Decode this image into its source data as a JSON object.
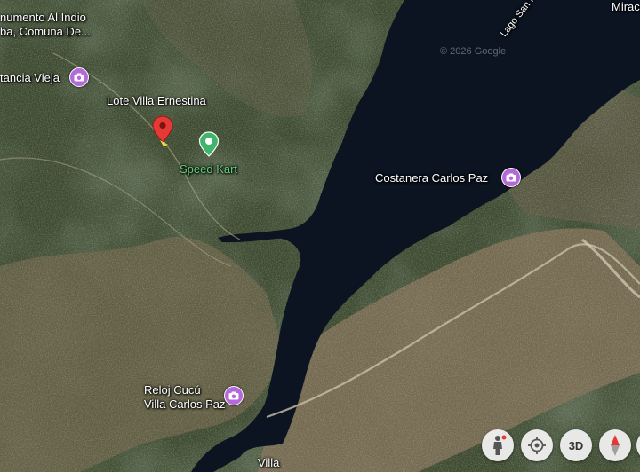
{
  "map": {
    "attribution": "© 2026 Google",
    "labels": {
      "monumento_line1": "numento Al Indio",
      "monumento_line2": "ba, Comuna De...",
      "estancia": "tancia Vieja",
      "lote": "Lote Villa Ernestina",
      "speed_kart": "Speed Kart",
      "costanera": "Costanera Carlos Paz",
      "reloj_line1": "Reloj Cucú",
      "reloj_line2": "Villa Carlos Paz",
      "lago": "Lago San Roque",
      "mirador": "Mirac",
      "villa": "Villa"
    },
    "controls": {
      "pegman": "pegman-icon",
      "my_location": "my-location-icon",
      "three_d": "3D",
      "compass": "compass-icon"
    },
    "colors": {
      "water": "#0b1420",
      "poi_purple": "#b469d8",
      "pin_red": "#e53935",
      "poi_green": "#3fb46a",
      "label_green": "#5fd07a"
    }
  }
}
